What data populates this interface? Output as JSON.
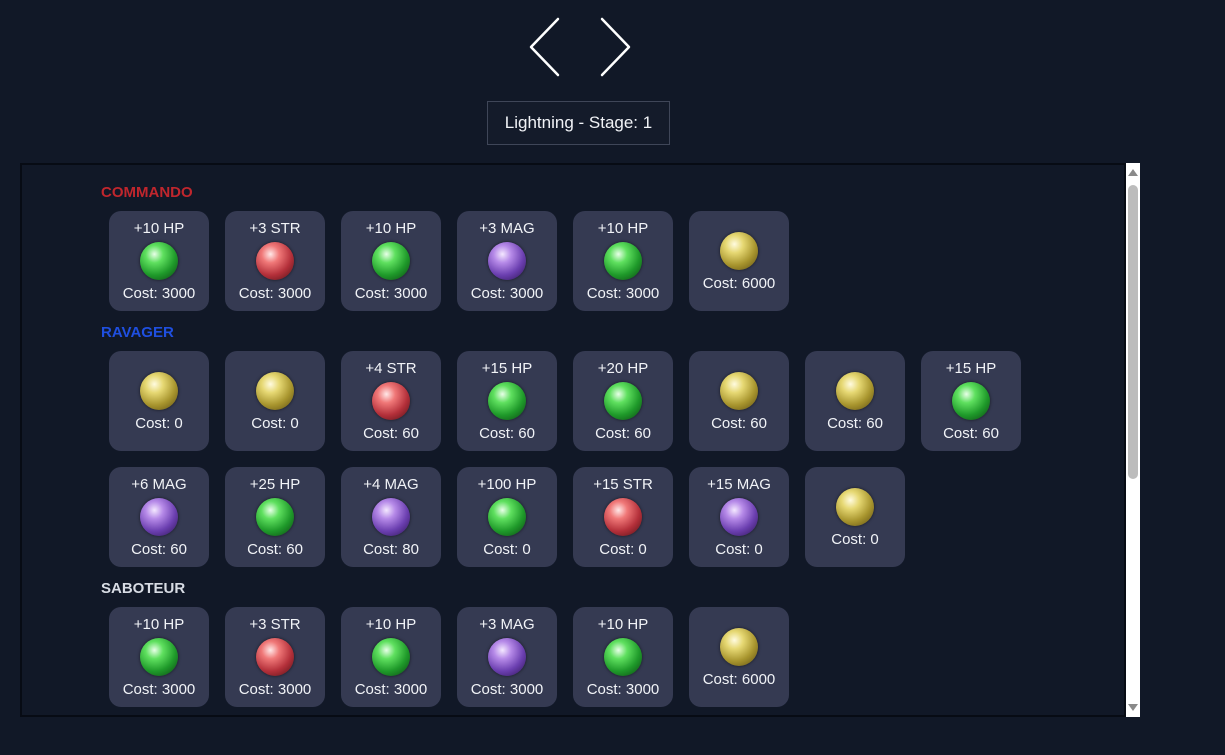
{
  "stage_label": "Lightning - Stage: 1",
  "colors": {
    "commando": "#c0262d",
    "ravager": "#1f4fe0",
    "saboteur": "#d8dce4",
    "background": "#111827",
    "card": "#353a52"
  },
  "sections": [
    {
      "heading": "COMMANDO",
      "rows": [
        [
          {
            "stat": "+10 HP",
            "orb": "green-orb",
            "cost": "Cost: 3000"
          },
          {
            "stat": "+3 STR",
            "orb": "red-orb",
            "cost": "Cost: 3000"
          },
          {
            "stat": "+10 HP",
            "orb": "green-orb",
            "cost": "Cost: 3000"
          },
          {
            "stat": "+3 MAG",
            "orb": "purple-orb",
            "cost": "Cost: 3000"
          },
          {
            "stat": "+10 HP",
            "orb": "green-orb",
            "cost": "Cost: 3000"
          },
          {
            "stat": "",
            "orb": "gold-orb",
            "cost": "Cost: 6000"
          }
        ]
      ]
    },
    {
      "heading": "RAVAGER",
      "rows": [
        [
          {
            "stat": "",
            "orb": "gold-orb",
            "cost": "Cost: 0"
          },
          {
            "stat": "",
            "orb": "gold-orb",
            "cost": "Cost: 0"
          },
          {
            "stat": "+4 STR",
            "orb": "red-orb",
            "cost": "Cost: 60"
          },
          {
            "stat": "+15 HP",
            "orb": "green-orb",
            "cost": "Cost: 60"
          },
          {
            "stat": "+20 HP",
            "orb": "green-orb",
            "cost": "Cost: 60"
          },
          {
            "stat": "",
            "orb": "gold-orb",
            "cost": "Cost: 60"
          },
          {
            "stat": "",
            "orb": "gold-orb",
            "cost": "Cost: 60"
          },
          {
            "stat": "+15 HP",
            "orb": "green-orb",
            "cost": "Cost: 60"
          }
        ],
        [
          {
            "stat": "+6 MAG",
            "orb": "purple-orb",
            "cost": "Cost: 60"
          },
          {
            "stat": "+25 HP",
            "orb": "green-orb",
            "cost": "Cost: 60"
          },
          {
            "stat": "+4 MAG",
            "orb": "purple-orb",
            "cost": "Cost: 80"
          },
          {
            "stat": "+100 HP",
            "orb": "green-orb",
            "cost": "Cost: 0"
          },
          {
            "stat": "+15 STR",
            "orb": "red-orb",
            "cost": "Cost: 0"
          },
          {
            "stat": "+15 MAG",
            "orb": "purple-orb",
            "cost": "Cost: 0"
          },
          {
            "stat": "",
            "orb": "gold-orb",
            "cost": "Cost: 0"
          }
        ]
      ]
    },
    {
      "heading": "SABOTEUR",
      "rows": [
        [
          {
            "stat": "+10 HP",
            "orb": "green-orb",
            "cost": "Cost: 3000"
          },
          {
            "stat": "+3 STR",
            "orb": "red-orb",
            "cost": "Cost: 3000"
          },
          {
            "stat": "+10 HP",
            "orb": "green-orb",
            "cost": "Cost: 3000"
          },
          {
            "stat": "+3 MAG",
            "orb": "purple-orb",
            "cost": "Cost: 3000"
          },
          {
            "stat": "+10 HP",
            "orb": "green-orb",
            "cost": "Cost: 3000"
          },
          {
            "stat": "",
            "orb": "gold-orb",
            "cost": "Cost: 6000"
          }
        ]
      ]
    }
  ]
}
